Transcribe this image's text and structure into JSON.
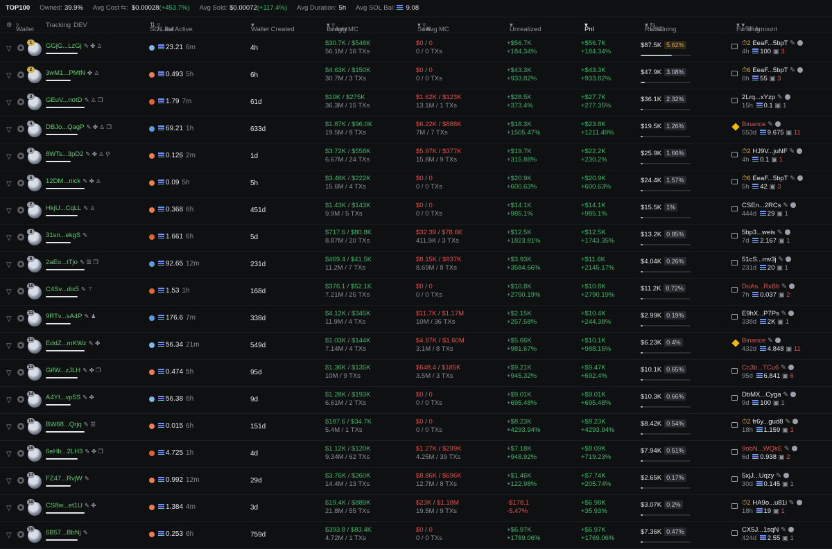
{
  "summary": {
    "title": "TOP100",
    "owned_label": "Owned:",
    "owned": "39.9%",
    "avg_cost_label": "Avg Cost",
    "avg_cost": "$0.00028",
    "avg_cost_chg": "(+453.7%)",
    "avg_sold_label": "Avg Sold:",
    "avg_sold": "$0.00072",
    "avg_sold_chg": "(+117.4%)",
    "avg_dur_label": "Avg Duration:",
    "avg_dur": "5h",
    "avg_sol_label": "Avg SOL Bal:",
    "avg_sol": "9.08"
  },
  "headers": {
    "wallet": "Wallet",
    "tracking": "Tracking",
    "dev": "DEV",
    "sol_bal": "SOL Bal",
    "last_active": "/ Last Active",
    "created": "Wallet Created",
    "bought": "Bought",
    "bought_mc": "/ Avg MC",
    "sold": "Sold",
    "sold_mc": "/ Avg MC",
    "unrealized": "Unrealized",
    "pnl": "Pnl",
    "remaining": "Remaining",
    "usd": "USD",
    "funding": "Funding",
    "tf_amount": "/ TF Amount"
  },
  "colors": {
    "green": "#3fb96a",
    "red": "#e0524f",
    "accent": "#63c973",
    "warn": "#e1a93f"
  },
  "rows": [
    {
      "rank": "1",
      "name": "GGjG...LzGj",
      "icons": "✎ ✤ ♙",
      "sol": "23.21",
      "sol_icon": "fish",
      "time": "6m",
      "created": "4h",
      "bought": "$30.7K",
      "bought_mc": "$548K",
      "bought_sub": "56.1M / 16 TXs",
      "sold": "$0",
      "sold_mc": "0",
      "sold_sub": "0 / 0 TXs",
      "unreal": "+$56.7K",
      "unreal_pct": "+184.34%",
      "pnl": "+$56.7K",
      "pnl_pct": "+184.34%",
      "rem": "$87.5K",
      "rem_pct": "5.62%",
      "rem_frac": 0.62,
      "fund_type": "tf",
      "fund_pri": "⏱2",
      "fund": "EeaF...5bpT",
      "fund_time": "4h",
      "fund_amt": "100",
      "fund_tx": "3"
    },
    {
      "rank": "2",
      "name": "3wM1...PMfN",
      "icons": "✤ ♙",
      "sol": "0.493",
      "sol_icon": "shrimp",
      "time": "5h",
      "created": "6h",
      "bought": "$4.63K",
      "bought_mc": "$150K",
      "bought_sub": "30.7M / 3 TXs",
      "sold": "$0",
      "sold_mc": "0",
      "sold_sub": "0 / 0 TXs",
      "unreal": "+$43.3K",
      "unreal_pct": "+933.82%",
      "pnl": "+$43.3K",
      "pnl_pct": "+933.82%",
      "rem": "$47.9K",
      "rem_pct": "3.08%",
      "rem_frac": 0.08,
      "fund_type": "tf",
      "fund_pri": "⏱6",
      "fund": "EeaF...5bpT",
      "fund_time": "6h",
      "fund_amt": "55",
      "fund_tx": "3"
    },
    {
      "rank": "3",
      "name": "GEuV...notD",
      "icons": "✎ ♙ ❒",
      "sol": "1.79",
      "sol_icon": "fire",
      "time": "7m",
      "created": "61d",
      "bought": "$10K",
      "bought_mc": "$275K",
      "bought_sub": "36.3M / 15 TXs",
      "sold": "$1.62K",
      "sold_mc": "$123K",
      "sold_sub": "13.1M / 1 TXs",
      "unreal": "+$28.5K",
      "unreal_pct": "+373.4%",
      "pnl": "+$27.7K",
      "pnl_pct": "+277.35%",
      "rem": "$36.1K",
      "rem_pct": "2.32%",
      "rem_frac": 0.04,
      "fund_type": "plain",
      "fund": "2Lrq...xYzp",
      "fund_time": "15h",
      "fund_amt": "0.1",
      "fund_tx": "1"
    },
    {
      "rank": "4",
      "name": "DBJo...QagP",
      "icons": "✎ ✤ ♙ ❒",
      "sol": "69.21",
      "sol_icon": "whale",
      "time": "1h",
      "created": "633d",
      "bought": "$1.87K",
      "bought_mc": "$96.0K",
      "bought_sub": "19.5M / 8 TXs",
      "sold": "$6.22K",
      "sold_mc": "$888K",
      "sold_sub": "7M / 7 TXs",
      "unreal": "+$18.3K",
      "unreal_pct": "+1505.47%",
      "pnl": "+$23.8K",
      "pnl_pct": "+1211.49%",
      "rem": "$19.5K",
      "rem_pct": "1.26%",
      "rem_frac": 0.03,
      "fund_type": "binance",
      "fund": "Binance",
      "fund_time": "553d",
      "fund_amt": "9.675",
      "fund_tx": "11"
    },
    {
      "rank": "5",
      "name": "8WTs...3pD2",
      "icons": "✎ ✤ ♙ ⚲",
      "sol": "0.126",
      "sol_icon": "shrimp",
      "time": "2m",
      "created": "1d",
      "bought": "$3.72K",
      "bought_mc": "$558K",
      "bought_sub": "6.67M / 24 TXs",
      "sold": "$5.97K",
      "sold_mc": "$377K",
      "sold_sub": "15.8M / 9 TXs",
      "unreal": "+$19.7K",
      "unreal_pct": "+315.88%",
      "pnl": "+$22.2K",
      "pnl_pct": "+230.2%",
      "rem": "$25.9K",
      "rem_pct": "1.66%",
      "rem_frac": 0.03,
      "fund_type": "tf",
      "fund_pri": "⏱2",
      "fund": "HJ9V...juNF",
      "fund_time": "4h",
      "fund_amt": "0.1",
      "fund_tx": "1"
    },
    {
      "rank": "6",
      "name": "12DM...nick",
      "icons": "✎ ✤ ♙",
      "sol": "0.09",
      "sol_icon": "shrimp",
      "time": "5h",
      "created": "5h",
      "bought": "$3.48K",
      "bought_mc": "$222K",
      "bought_sub": "15.6M / 4 TXs",
      "sold": "$0",
      "sold_mc": "0",
      "sold_sub": "0 / 0 TXs",
      "unreal": "+$20.9K",
      "unreal_pct": "+600.63%",
      "pnl": "+$20.9K",
      "pnl_pct": "+600.63%",
      "rem": "$24.4K",
      "rem_pct": "1.57%",
      "rem_frac": 0.03,
      "fund_type": "tf",
      "fund_pri": "⏱6",
      "fund": "EeaF...5bpT",
      "fund_time": "5h",
      "fund_amt": "42",
      "fund_tx": "3"
    },
    {
      "rank": "7",
      "name": "HkjU...CqLL",
      "icons": "✎ ♙",
      "sol": "0.368",
      "sol_icon": "shrimp",
      "time": "6h",
      "created": "451d",
      "bought": "$1.43K",
      "bought_mc": "$143K",
      "bought_sub": "9.9M / 5 TXs",
      "sold": "$0",
      "sold_mc": "0",
      "sold_sub": "0 / 0 TXs",
      "unreal": "+$14.1K",
      "unreal_pct": "+985.1%",
      "pnl": "+$14.1K",
      "pnl_pct": "+985.1%",
      "rem": "$15.5K",
      "rem_pct": "1%",
      "rem_frac": 0.02,
      "fund_type": "plain",
      "fund": "CSEn...2RCs",
      "fund_time": "444d",
      "fund_amt": "29",
      "fund_tx": "1"
    },
    {
      "rank": "8",
      "name": "31sn...ekgS",
      "icons": "✎",
      "sol": "1.661",
      "sol_icon": "fire",
      "time": "6h",
      "created": "5d",
      "bought": "$717.6",
      "bought_mc": "$80.8K",
      "bought_sub": "8.87M / 20 TXs",
      "sold": "$32.39",
      "sold_mc": "$78.6K",
      "sold_sub": "411.9K / 3 TXs",
      "unreal": "+$12.5K",
      "unreal_pct": "+1823.81%",
      "pnl": "+$12.5K",
      "pnl_pct": "+1743.35%",
      "rem": "$13.2K",
      "rem_pct": "0.85%",
      "rem_frac": 0.02,
      "fund_type": "plain",
      "fund": "5bp3...weis",
      "fund_time": "7d",
      "fund_amt": "2.167",
      "fund_tx": "1"
    },
    {
      "rank": "9",
      "name": "2aEo...tTjo",
      "icons": "✎ ☰ ❒",
      "sol": "92.65",
      "sol_icon": "whale",
      "time": "12m",
      "created": "231d",
      "bought": "$469.4",
      "bought_mc": "$41.5K",
      "bought_sub": "11.2M / 7 TXs",
      "sold": "$8.15K",
      "sold_mc": "$937K",
      "sold_sub": "8.69M / 8 TXs",
      "unreal": "+$3.93K",
      "unreal_pct": "+3584.66%",
      "pnl": "+$11.6K",
      "pnl_pct": "+2145.17%",
      "rem": "$4.04K",
      "rem_pct": "0.26%",
      "rem_frac": 0.01,
      "fund_type": "plain",
      "fund": "51cS...mv3j",
      "fund_time": "231d",
      "fund_amt": "20",
      "fund_tx": "1"
    },
    {
      "rank": "10",
      "name": "C4Sv...dix5",
      "icons": "✎ ⚚",
      "sol": "1.53",
      "sol_icon": "fire",
      "time": "1h",
      "created": "168d",
      "bought": "$376.1",
      "bought_mc": "$52.1K",
      "bought_sub": "7.21M / 25 TXs",
      "sold": "$0",
      "sold_mc": "0",
      "sold_sub": "0 / 0 TXs",
      "unreal": "+$10.8K",
      "unreal_pct": "+2790.19%",
      "pnl": "+$10.8K",
      "pnl_pct": "+2790.19%",
      "rem": "$11.2K",
      "rem_pct": "0.72%",
      "rem_frac": 0.02,
      "fund_type": "exchange",
      "fund": "DoAs...RxBb",
      "fund_time": "7h",
      "fund_amt": "0.037",
      "fund_tx": "2"
    },
    {
      "rank": "11",
      "name": "9RTv...sA4P",
      "icons": "✎ ♟",
      "sol": "176.6",
      "sol_icon": "whale",
      "time": "7m",
      "created": "338d",
      "bought": "$4.12K",
      "bought_mc": "$345K",
      "bought_sub": "11.9M / 4 TXs",
      "sold": "$11.7K",
      "sold_mc": "$1.17M",
      "sold_sub": "10M / 36 TXs",
      "unreal": "+$2.15K",
      "unreal_pct": "+257.58%",
      "pnl": "+$10.4K",
      "pnl_pct": "+244.38%",
      "rem": "$2.99K",
      "rem_pct": "0.19%",
      "rem_frac": 0.01,
      "fund_type": "plain",
      "fund": "E9hX...P7Ps",
      "fund_time": "338d",
      "fund_amt": "2K",
      "fund_tx": "1"
    },
    {
      "rank": "12",
      "name": "EddZ...mKWz",
      "icons": "✎ ✤",
      "sol": "56.34",
      "sol_icon": "fish",
      "time": "21m",
      "created": "549d",
      "bought": "$1.03K",
      "bought_mc": "$144K",
      "bought_sub": "7.14M / 4 TXs",
      "sold": "$4.97K",
      "sold_mc": "$1.60M",
      "sold_sub": "3.1M / 8 TXs",
      "unreal": "+$5.66K",
      "unreal_pct": "+981.67%",
      "pnl": "+$10.1K",
      "pnl_pct": "+988.15%",
      "rem": "$6.23K",
      "rem_pct": "0.4%",
      "rem_frac": 0.01,
      "fund_type": "binance",
      "fund": "Binance",
      "fund_time": "432d",
      "fund_amt": "4.848",
      "fund_tx": "11"
    },
    {
      "rank": "13",
      "name": "GifW...zJLH",
      "icons": "✎ ✤ ❒",
      "sol": "0.474",
      "sol_icon": "shrimp",
      "time": "5h",
      "created": "95d",
      "bought": "$1.36K",
      "bought_mc": "$135K",
      "bought_sub": "10M / 9 TXs",
      "sold": "$648.4",
      "sold_mc": "$185K",
      "sold_sub": "3.5M / 3 TXs",
      "unreal": "+$9.21K",
      "unreal_pct": "+945.32%",
      "pnl": "+$9.47K",
      "pnl_pct": "+692.4%",
      "rem": "$10.1K",
      "rem_pct": "0.65%",
      "rem_frac": 0.01,
      "fund_type": "exchange",
      "fund": "Cc3b...TCu6",
      "fund_time": "95d",
      "fund_amt": "6.841",
      "fund_tx": "6"
    },
    {
      "rank": "14",
      "name": "A4Yf...vp5S",
      "icons": "✎ ✤",
      "sol": "56.38",
      "sol_icon": "fish",
      "time": "6h",
      "created": "9d",
      "bought": "$1.28K",
      "bought_mc": "$193K",
      "bought_sub": "6.61M / 2 TXs",
      "sold": "$0",
      "sold_mc": "0",
      "sold_sub": "0 / 0 TXs",
      "unreal": "+$9.01K",
      "unreal_pct": "+695.48%",
      "pnl": "+$9.01K",
      "pnl_pct": "+695.48%",
      "rem": "$10.3K",
      "rem_pct": "0.66%",
      "rem_frac": 0.01,
      "fund_type": "plain",
      "fund": "DbMX...Cyga",
      "fund_time": "9d",
      "fund_amt": "100",
      "fund_tx": "1"
    },
    {
      "rank": "15",
      "name": "BW68...Qrjq",
      "icons": "✎ ☰",
      "sol": "0.015",
      "sol_icon": "shrimp",
      "time": "6h",
      "created": "151d",
      "bought": "$187.6",
      "bought_mc": "$34.7K",
      "bought_sub": "5.4M / 1 TXs",
      "sold": "$0",
      "sold_mc": "0",
      "sold_sub": "0 / 0 TXs",
      "unreal": "+$8.23K",
      "unreal_pct": "+4293.94%",
      "pnl": "+$8.23K",
      "pnl_pct": "+4293.94%",
      "rem": "$8.42K",
      "rem_pct": "0.54%",
      "rem_frac": 0.01,
      "fund_type": "tf",
      "fund_pri": "⏱2",
      "fund": "fr6y...gud8",
      "fund_time": "18h",
      "fund_amt": "1.159",
      "fund_tx": "1"
    },
    {
      "rank": "16",
      "name": "6eHb...2LH3",
      "icons": "✎ ✤ ❒",
      "sol": "4.725",
      "sol_icon": "fire",
      "time": "1h",
      "created": "4d",
      "bought": "$1.12K",
      "bought_mc": "$120K",
      "bought_sub": "9.34M / 62 TXs",
      "sold": "$1.27K",
      "sold_mc": "$299K",
      "sold_sub": "4.25M / 39 TXs",
      "unreal": "+$7.18K",
      "unreal_pct": "+948.92%",
      "pnl": "+$8.09K",
      "pnl_pct": "+719.23%",
      "rem": "$7.94K",
      "rem_pct": "0.51%",
      "rem_frac": 0.01,
      "fund_type": "exchange",
      "fund": "9obN...WQkE",
      "fund_time": "6d",
      "fund_amt": "0.938",
      "fund_tx": "2"
    },
    {
      "rank": "17",
      "name": "FZ47...RvjW",
      "icons": "✎",
      "sol": "0.992",
      "sol_icon": "shrimp",
      "time": "12m",
      "created": "29d",
      "bought": "$3.76K",
      "bought_mc": "$260K",
      "bought_sub": "14.4M / 13 TXs",
      "sold": "$8.86K",
      "sold_mc": "$696K",
      "sold_sub": "12.7M / 8 TXs",
      "unreal": "+$1.46K",
      "unreal_pct": "+122.98%",
      "pnl": "+$7.74K",
      "pnl_pct": "+205.74%",
      "rem": "$2.65K",
      "rem_pct": "0.17%",
      "rem_frac": 0.01,
      "fund_type": "plain",
      "fund": "5xjJ...Uqzy",
      "fund_time": "30d",
      "fund_amt": "0.145",
      "fund_tx": "1"
    },
    {
      "rank": "18",
      "name": "CS8w...et1U",
      "icons": "✎ ✤",
      "sol": "1.384",
      "sol_icon": "shrimp",
      "time": "4m",
      "created": "3d",
      "bought": "$19.4K",
      "bought_mc": "$889K",
      "bought_sub": "21.8M / 55 TXs",
      "sold": "$23K",
      "sold_mc": "$1.18M",
      "sold_sub": "19.5M / 9 TXs",
      "unreal": "-$178.1",
      "unreal_pct": "-5.47%",
      "pnl": "+$6.98K",
      "pnl_pct": "+35.93%",
      "rem": "$3.07K",
      "rem_pct": "0.2%",
      "rem_frac": 0.01,
      "fund_type": "tf",
      "fund_pri": "⏱2",
      "fund": "HA9o...u81i",
      "fund_time": "18h",
      "fund_amt": "19",
      "fund_tx": "1"
    },
    {
      "rank": "19",
      "name": "6B57...BbNj",
      "icons": "✎",
      "sol": "0.253",
      "sol_icon": "shrimp",
      "time": "6h",
      "created": "759d",
      "bought": "$393.8",
      "bought_mc": "$83.4K",
      "bought_sub": "4.72M / 1 TXs",
      "sold": "$0",
      "sold_mc": "0",
      "sold_sub": "0 / 0 TXs",
      "unreal": "+$6.97K",
      "unreal_pct": "+1769.06%",
      "pnl": "+$6.97K",
      "pnl_pct": "+1769.06%",
      "rem": "$7.36K",
      "rem_pct": "0.47%",
      "rem_frac": 0.01,
      "fund_type": "plain",
      "fund": "CX5J...1sqN",
      "fund_time": "424d",
      "fund_amt": "2.55",
      "fund_tx": "1"
    }
  ]
}
